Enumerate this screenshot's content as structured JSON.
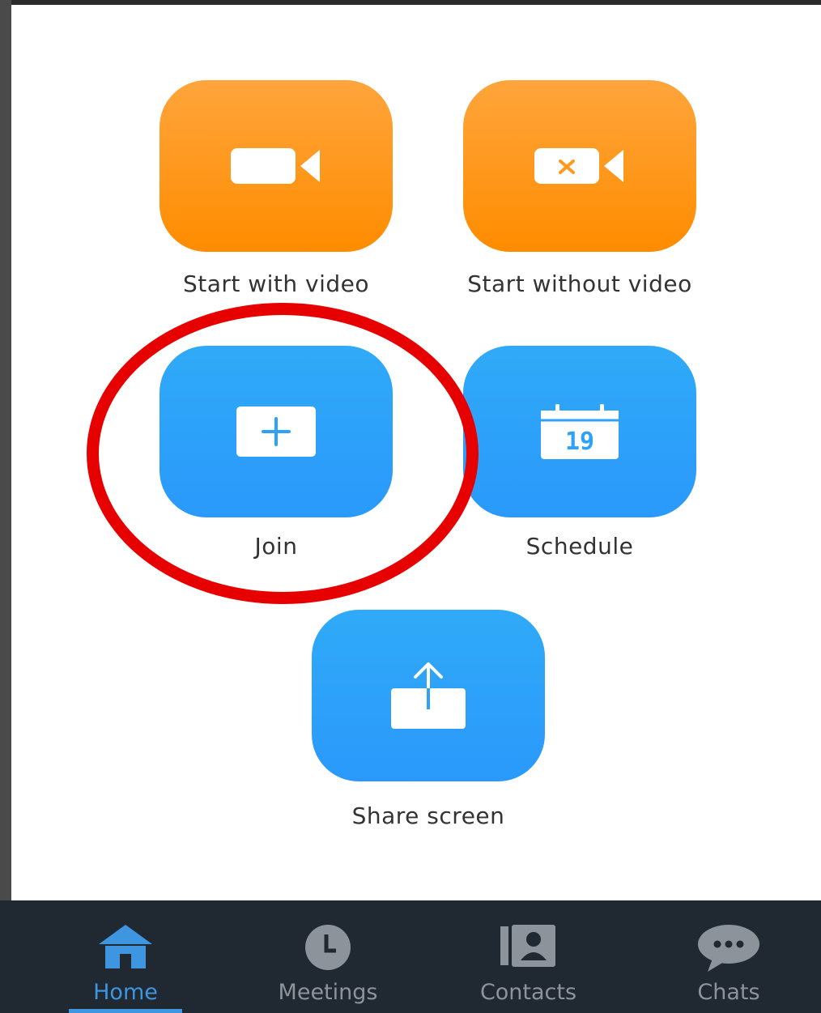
{
  "actions": {
    "start_with_video": "Start with video",
    "start_without_video": "Start without video",
    "join": "Join",
    "schedule": "Schedule",
    "share_screen": "Share screen"
  },
  "calendar_day": "19",
  "nav": {
    "home": "Home",
    "meetings": "Meetings",
    "contacts": "Contacts",
    "chats": "Chats",
    "active": "Home"
  },
  "colors": {
    "orange_tile": "#ff9a1f",
    "blue_tile": "#2ea2fa",
    "highlight": "#e60000",
    "nav_bg": "#202831",
    "nav_active": "#3e95e0"
  }
}
